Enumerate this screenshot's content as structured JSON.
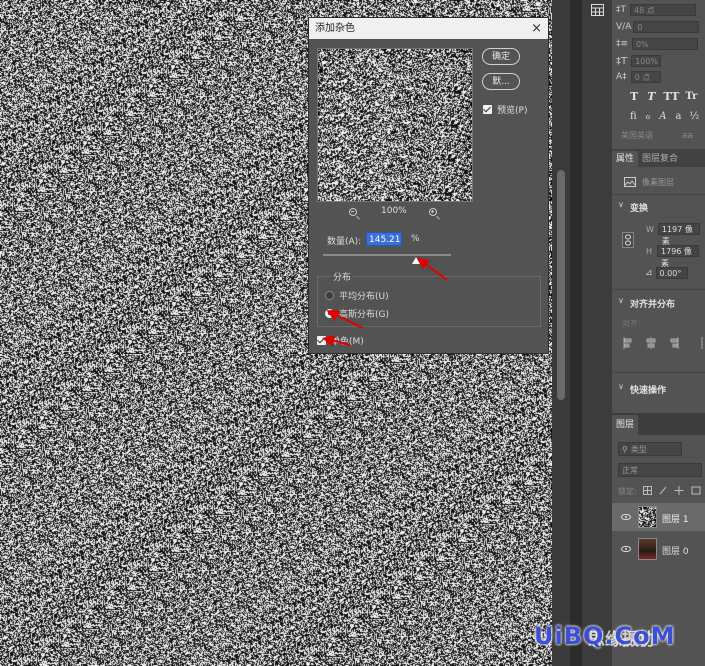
{
  "dialog": {
    "title": "添加杂色",
    "ok_label": "确定",
    "default_label": "默...",
    "preview_label": "预览(P)",
    "preview_checked": true,
    "zoom_value": "100%",
    "amount_label": "数量(A):",
    "amount_value": "145.21",
    "amount_unit": "%",
    "distribution_label": "分布",
    "uniform_label": "平均分布(U)",
    "gaussian_label": "高斯分布(G)",
    "selected_distribution": "gaussian",
    "mono_label": "单色(M)",
    "mono_checked": true,
    "close_glyph": "×"
  },
  "character_panel": {
    "leading": "48 点",
    "tracking": "0",
    "scale": "0%",
    "vscale": "100%",
    "baseline": "0 点",
    "style_buttons": [
      "T",
      "T",
      "TT",
      "Tr"
    ],
    "language": "美国英语",
    "aa": "aa"
  },
  "properties_panel": {
    "tab_properties": "属性",
    "tab_adjust": "图层复合",
    "layer_type": "像素图层",
    "transform_label": "变换",
    "w_label": "W",
    "w_value": "1197 像素",
    "h_label": "H",
    "h_value": "1796 像素",
    "angle_value": "0.00°",
    "align_label": "对齐并分布",
    "align_sub": "对齐:",
    "quick_actions": "快速操作"
  },
  "layers_panel": {
    "tab": "图层",
    "filter_placeholder": "类型",
    "blend_mode": "正常",
    "lock_label": "锁定:",
    "layers": [
      {
        "name": "图层 1"
      },
      {
        "name": "图层 0"
      }
    ]
  },
  "watermark": {
    "text": "UiBQ.CoM",
    "overlay": "思缘摄协"
  },
  "colors": {
    "accent_blue": "#3b6fd8",
    "arrow_red": "#e00000",
    "watermark_blue": "#3c4fd6"
  }
}
